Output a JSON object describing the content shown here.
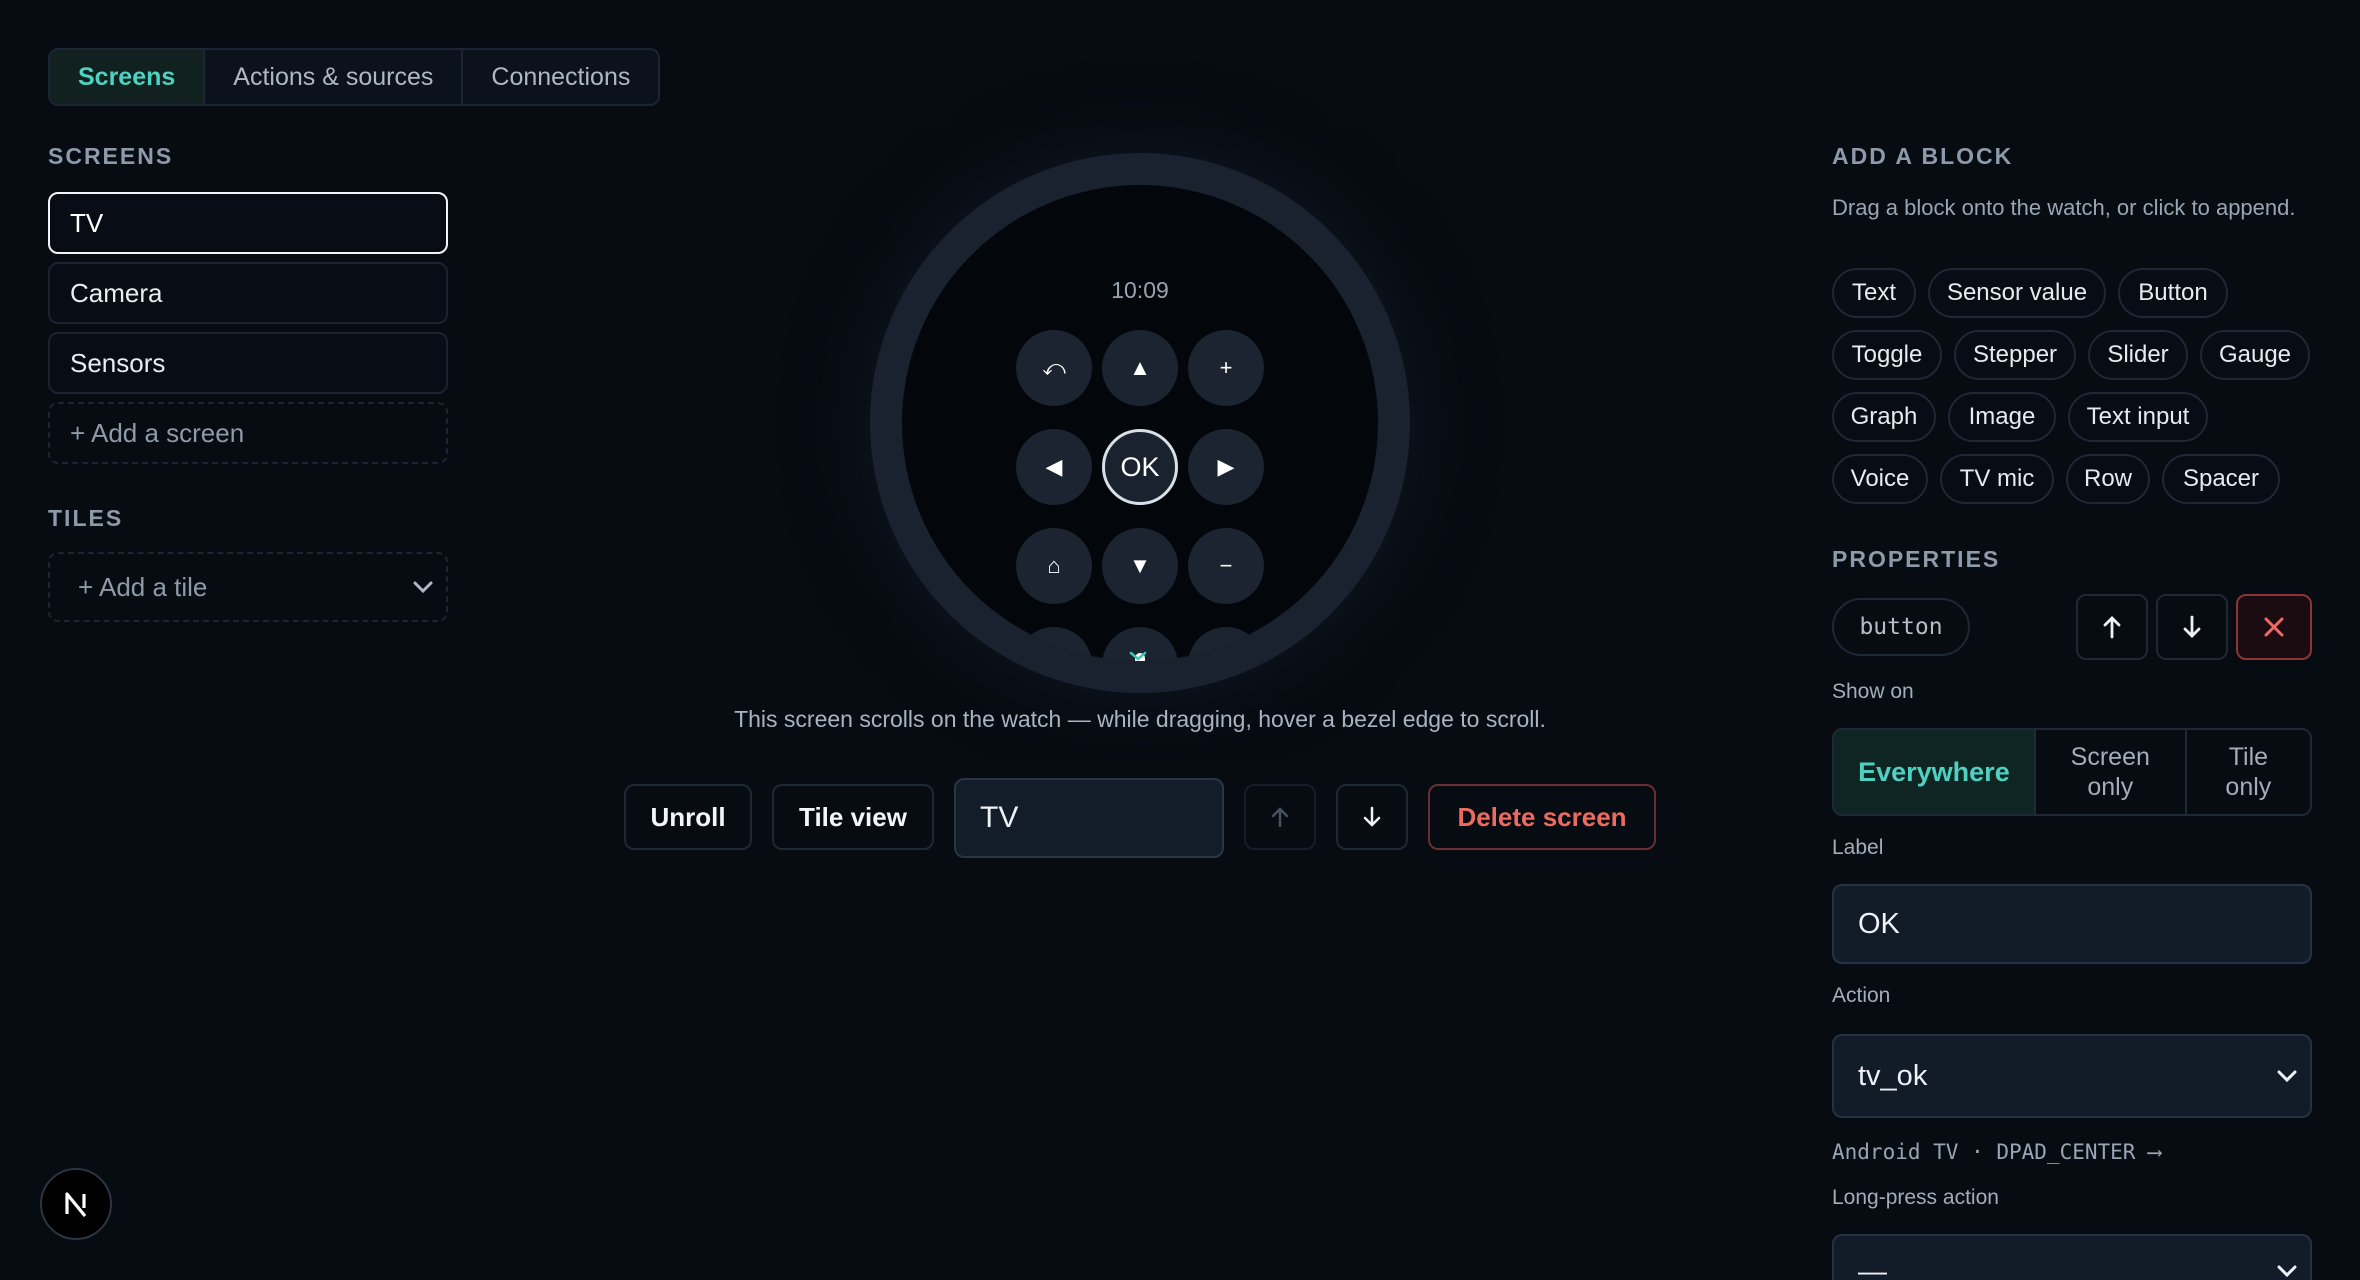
{
  "tabs": [
    {
      "label": "Screens",
      "active": true
    },
    {
      "label": "Actions & sources",
      "active": false
    },
    {
      "label": "Connections",
      "active": false
    }
  ],
  "screens": {
    "title": "SCREENS",
    "items": [
      "TV",
      "Camera",
      "Sensors"
    ],
    "selected": "TV",
    "add_label": "+ Add a screen"
  },
  "tiles": {
    "title": "TILES",
    "add_label": "+ Add a tile"
  },
  "watch": {
    "time": "10:09",
    "ok_label": "OK",
    "buttons": {
      "back": "⤺",
      "up": "▲",
      "plus": "+",
      "left": "◀",
      "right": "▶",
      "home": "⌂",
      "down": "▼",
      "minus": "−"
    },
    "scroll_position": 0.0
  },
  "hint": "This screen scrolls on the watch — while dragging, hover a bezel edge to scroll.",
  "toolbar": {
    "unroll": "Unroll",
    "tile_view": "Tile view",
    "screen_name": "TV",
    "delete": "Delete screen"
  },
  "add_block": {
    "title": "ADD A BLOCK",
    "description": "Drag a block onto the watch, or click to append.",
    "blocks": [
      "Text",
      "Sensor value",
      "Button",
      "Toggle",
      "Stepper",
      "Slider",
      "Gauge",
      "Graph",
      "Image",
      "Text input",
      "Voice",
      "TV mic",
      "Row",
      "Spacer"
    ]
  },
  "properties": {
    "title": "PROPERTIES",
    "block_type": "button",
    "show_on_label": "Show on",
    "show_on_options": [
      "Everywhere",
      "Screen only",
      "Tile only"
    ],
    "show_on_selected": "Everywhere",
    "label_label": "Label",
    "label_value": "OK",
    "action_label": "Action",
    "action_value": "tv_ok",
    "action_note": "Android TV · DPAD_CENTER ⟶",
    "long_press_label": "Long-press action",
    "long_press_value": "—"
  },
  "colors": {
    "background": "#070b12",
    "accent": "#4fd1c1",
    "danger": "#ec6a60"
  }
}
